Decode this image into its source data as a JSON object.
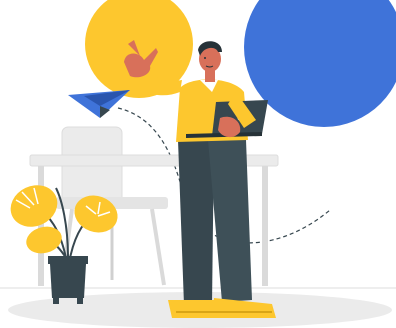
{
  "palette": {
    "yellow": "#FDC72E",
    "blue": "#3F73D9",
    "skin": "#D8705A",
    "dark": "#37474F",
    "grey_light": "#EBEBEB",
    "grey_mid": "#DADADA",
    "white": "#FFFFFF"
  },
  "illustration": {
    "subject": "man-holding-laptop-pointing",
    "elements": [
      "yellow-circle",
      "blue-circle",
      "paper-plane",
      "dashed-flight-path",
      "office-chair",
      "desk",
      "potted-monstera-plant",
      "floor-shadow"
    ]
  }
}
